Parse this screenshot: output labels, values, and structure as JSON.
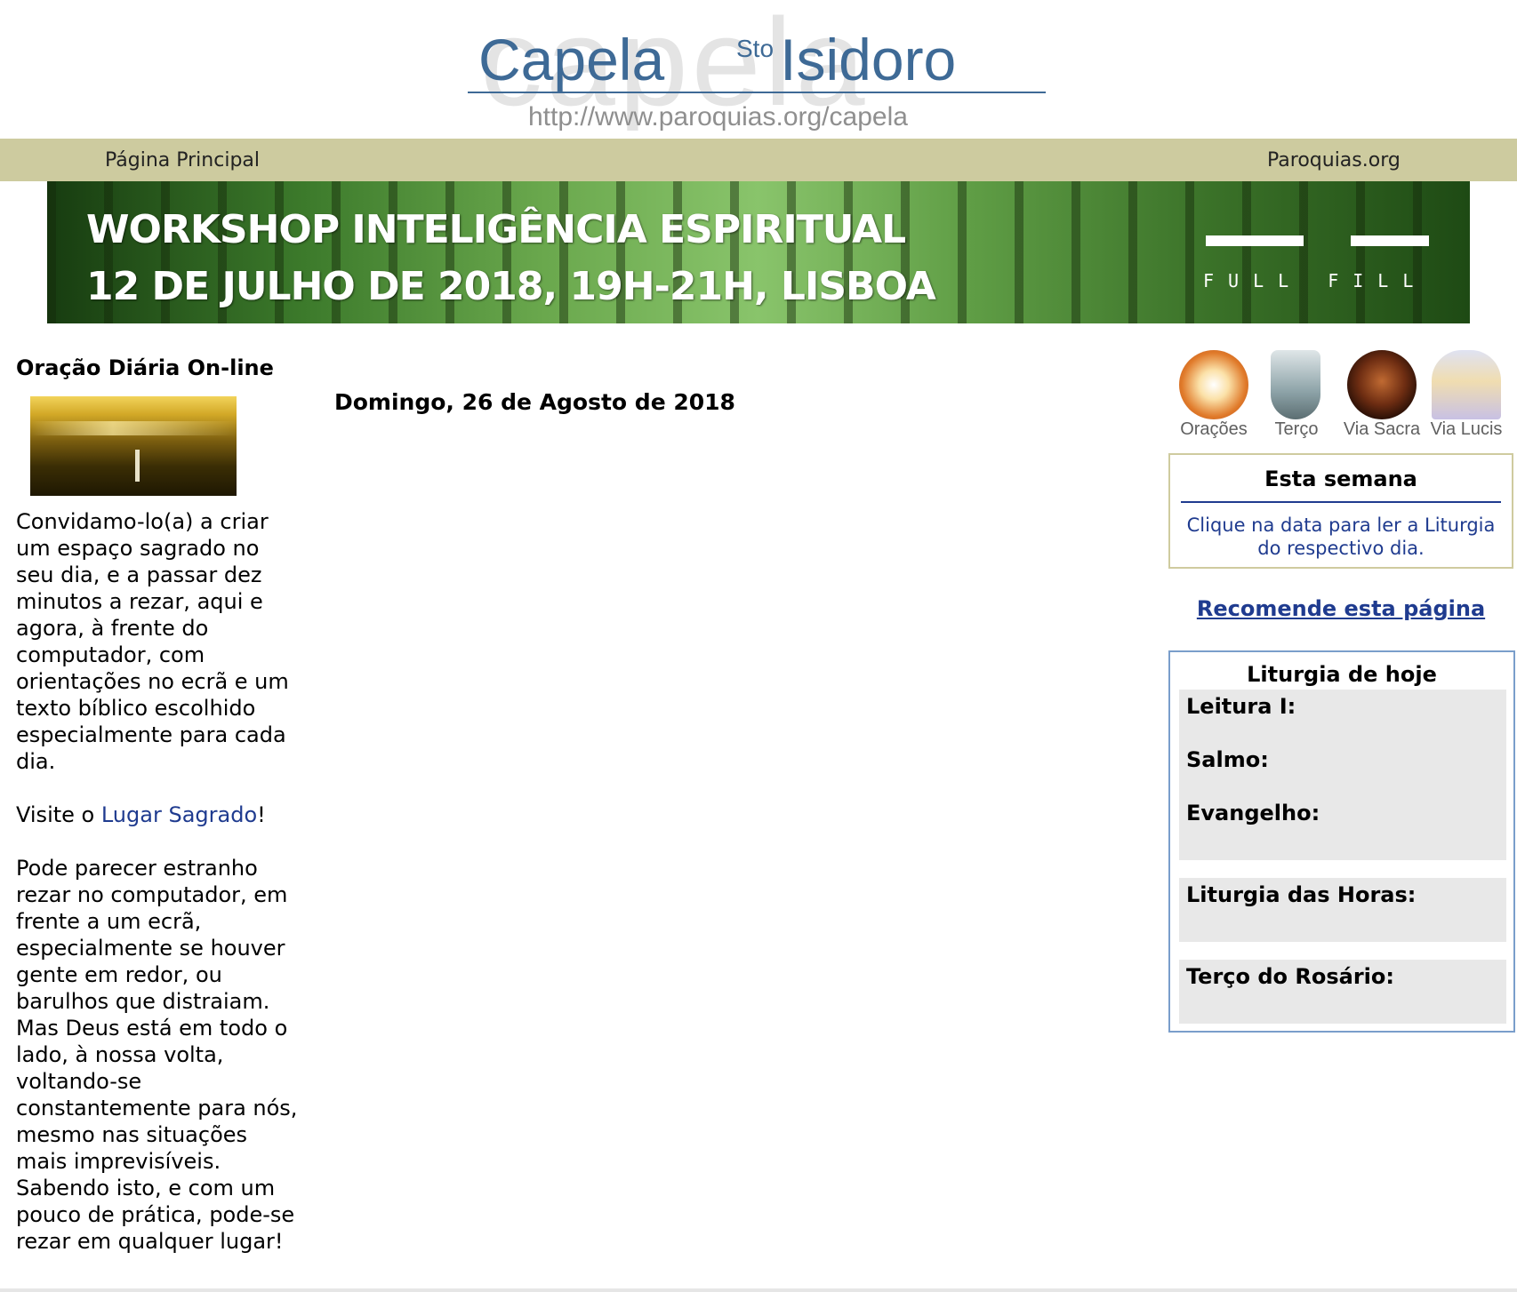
{
  "header": {
    "title": "Capela",
    "title_suffix": "Isidoro",
    "sto": "Sto",
    "watermark": "capela",
    "url": "http://www.paroquias.org/capela"
  },
  "nav": {
    "home": "Página Principal",
    "paroquias": "Paroquias.org"
  },
  "banner": {
    "line1": "WORKSHOP INTELIGÊNCIA ESPIRITUAL",
    "line2": "12 DE JULHO DE 2018, 19H-21H, LISBOA",
    "brand": "FULL FILL"
  },
  "left": {
    "heading": "Oração Diária On-line",
    "para1": "Convidamo-lo(a) a criar um espaço sagrado no seu dia, e a passar dez minutos a rezar, aqui e agora, à frente do computador, com orientações no ecrã e um texto bíblico escolhido especialmente para cada dia.",
    "visit_prefix": "Visite o ",
    "visit_link": "Lugar Sagrado",
    "visit_suffix": "!",
    "para3": "Pode parecer estranho rezar no computador, em frente a um ecrã, especialmente se houver gente em redor, ou barulhos que distraiam. Mas Deus está em todo o lado, à nossa volta, voltando-se constantemente para nós, mesmo nas situações mais imprevisíveis. Sabendo isto, e com um pouco de prática, pode-se rezar em qualquer lugar!"
  },
  "main": {
    "date": "Domingo, 26 de Agosto de 2018"
  },
  "icons": {
    "items": [
      {
        "label": "Orações"
      },
      {
        "label": "Terço"
      },
      {
        "label": "Via Sacra"
      },
      {
        "label": "Via Lucis"
      }
    ]
  },
  "esta_semana": {
    "title": "Esta semana",
    "text": "Clique na data para ler a Liturgia do respectivo dia."
  },
  "recomende": "Recomende esta página",
  "liturgia": {
    "title": "Liturgia de hoje",
    "leitura": "Leitura I:",
    "salmo": "Salmo:",
    "evangelho": "Evangelho:",
    "horas": "Liturgia das Horas:",
    "terco": "Terço do Rosário:"
  },
  "colors": {
    "nav_bg": "#cdcb9f",
    "link": "#1f3b8f",
    "logo": "#3e6a96"
  }
}
